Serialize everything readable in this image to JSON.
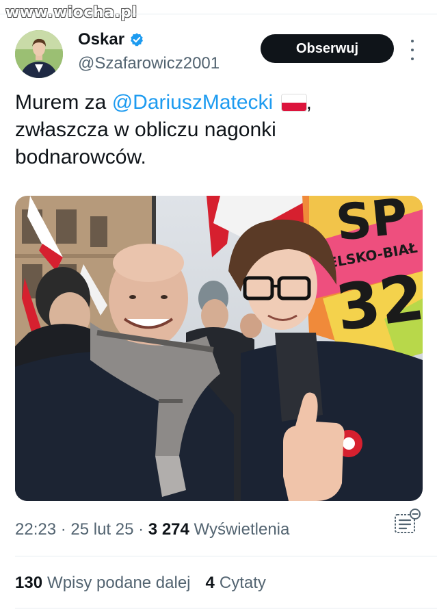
{
  "watermark": "www.wiocha.pl",
  "author": {
    "display_name": "Oskar",
    "handle": "@Szafarowicz2001",
    "verified": true
  },
  "follow_label": "Obserwuj",
  "tweet": {
    "prefix": "Murem za ",
    "mention": "@DariuszMatecki",
    "flag_icon": "poland-flag-icon",
    "after_flag": ",",
    "line2": "zwłaszcza w obliczu nagonki",
    "line3": "bodnarowców."
  },
  "photo": {
    "sign_text_1": "SP",
    "sign_text_2": "ELSKO-BIAŁ",
    "sign_text_3": "32"
  },
  "meta": {
    "time": "22:23",
    "date": "25 lut 25",
    "views_count": "3 274",
    "views_label": "Wyświetlenia"
  },
  "stats": {
    "retweets_count": "130",
    "retweets_label": "Wpisy podane dalej",
    "quotes_count": "4",
    "quotes_label": "Cytaty"
  },
  "colors": {
    "accent": "#1d9bf0",
    "text": "#0f1419",
    "muted": "#536471",
    "button": "#0f1419"
  }
}
